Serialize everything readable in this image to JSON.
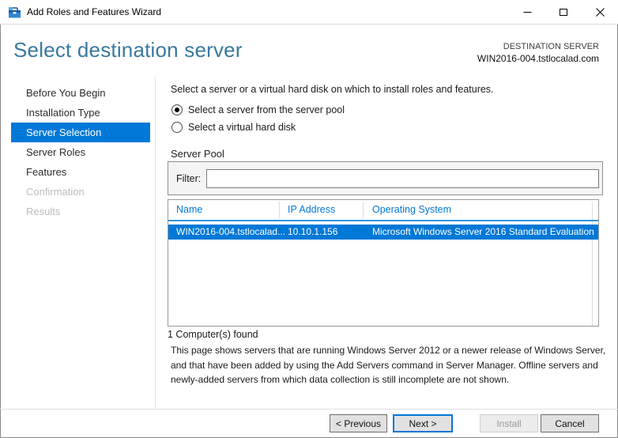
{
  "window": {
    "title": "Add Roles and Features Wizard",
    "controls": {
      "minimize": "minimize",
      "maximize": "maximize",
      "close": "close"
    }
  },
  "header": {
    "title": "Select destination server",
    "destination_label": "DESTINATION SERVER",
    "destination_server": "WIN2016-004.tstlocalad.com"
  },
  "sidebar": {
    "items": [
      {
        "label": "Before You Begin",
        "state": "enabled"
      },
      {
        "label": "Installation Type",
        "state": "enabled"
      },
      {
        "label": "Server Selection",
        "state": "selected"
      },
      {
        "label": "Server Roles",
        "state": "enabled"
      },
      {
        "label": "Features",
        "state": "enabled"
      },
      {
        "label": "Confirmation",
        "state": "disabled"
      },
      {
        "label": "Results",
        "state": "disabled"
      }
    ]
  },
  "content": {
    "intro": "Select a server or a virtual hard disk on which to install roles and features.",
    "radios": [
      {
        "label": "Select a server from the server pool",
        "selected": true
      },
      {
        "label": "Select a virtual hard disk",
        "selected": false
      }
    ],
    "server_pool": {
      "title": "Server Pool",
      "filter_label": "Filter:",
      "filter_value": "",
      "table": {
        "columns": [
          "Name",
          "IP Address",
          "Operating System"
        ],
        "rows": [
          {
            "name": "WIN2016-004.tstlocalad....",
            "ip": "10.10.1.156",
            "os": "Microsoft Windows Server 2016 Standard Evaluation",
            "selected": true
          }
        ]
      },
      "found_text": "1 Computer(s) found"
    },
    "description": "This page shows servers that are running Windows Server 2012 or a newer release of Windows Server, and that have been added by using the Add Servers command in Server Manager. Offline servers and newly-added servers from which data collection is still incomplete are not shown."
  },
  "footer": {
    "buttons": [
      {
        "label": "< Previous",
        "state": "enabled"
      },
      {
        "label": "Next >",
        "state": "default"
      },
      {
        "label": "Install",
        "state": "disabled"
      },
      {
        "label": "Cancel",
        "state": "enabled"
      }
    ]
  },
  "colors": {
    "accent": "#0078D7",
    "title_text": "#39799E",
    "header_underline": "#3095E3",
    "selected_row_bg": "#0078D7",
    "disabled_text": "#BDBDBD"
  }
}
